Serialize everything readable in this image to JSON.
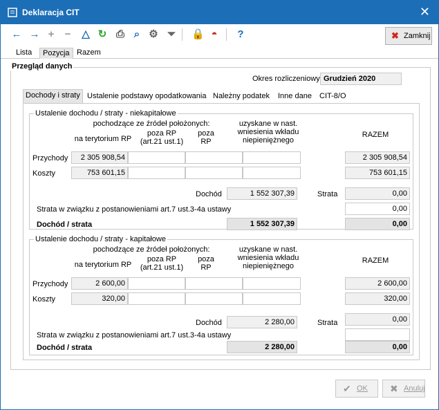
{
  "window": {
    "title": "Deklaracja CIT"
  },
  "toolbar": {
    "icons": [
      "arrow-left-icon",
      "arrow-right-icon",
      "plus-icon",
      "minus-icon",
      "triangle-icon",
      "refresh-icon",
      "print-icon",
      "search-icon",
      "settings-icon",
      "filter-icon",
      "lock-icon",
      "brush-icon",
      "help-icon"
    ],
    "close_label": "Zamknij"
  },
  "top_tabs": [
    "Lista",
    "Pozycja",
    "Razem"
  ],
  "overview": {
    "title": "Przegląd danych",
    "period_label": "Okres rozliczeniowy",
    "period_value": "Grudzień 2020"
  },
  "inner_tabs": [
    "Dochody i straty",
    "Ustalenie podstawy opodatkowania",
    "Należny podatek",
    "Inne dane",
    "CIT-8/O"
  ],
  "headers": {
    "source_group": "pochodzące ze źródeł położonych:",
    "domestic": "na terytorium RP",
    "abroad_art21": "poza RP\n(art.21 ust.1)",
    "abroad": "poza\nRP",
    "contribution": "uzyskane w nast.\nwniesienia wkładu\nniepieniężnego",
    "total": "RAZEM",
    "revenue": "Przychody",
    "costs": "Koszty",
    "income": "Dochód",
    "loss": "Strata",
    "loss_art7": "Strata w związku z postanowieniami art.7 ust.3-4a ustawy",
    "income_loss": "Dochód / strata"
  },
  "sections": [
    {
      "title": "Ustalenie dochodu / straty - niekapitałowe",
      "revenue_domestic": "2 305 908,54",
      "revenue_total": "2 305 908,54",
      "costs_domestic": "753 601,15",
      "costs_total": "753 601,15",
      "income": "1 552 307,39",
      "loss": "0,00",
      "loss_art7": "0,00",
      "income_loss": "1 552 307,39",
      "income_loss_total": "0,00"
    },
    {
      "title": "Ustalenie dochodu / straty - kapitałowe",
      "revenue_domestic": "2 600,00",
      "revenue_total": "2 600,00",
      "costs_domestic": "320,00",
      "costs_total": "320,00",
      "income": "2 280,00",
      "loss": "0,00",
      "loss_art7": "",
      "income_loss": "2 280,00",
      "income_loss_total": "0,00"
    }
  ],
  "buttons": {
    "ok": "OK",
    "cancel": "Anuluj"
  }
}
